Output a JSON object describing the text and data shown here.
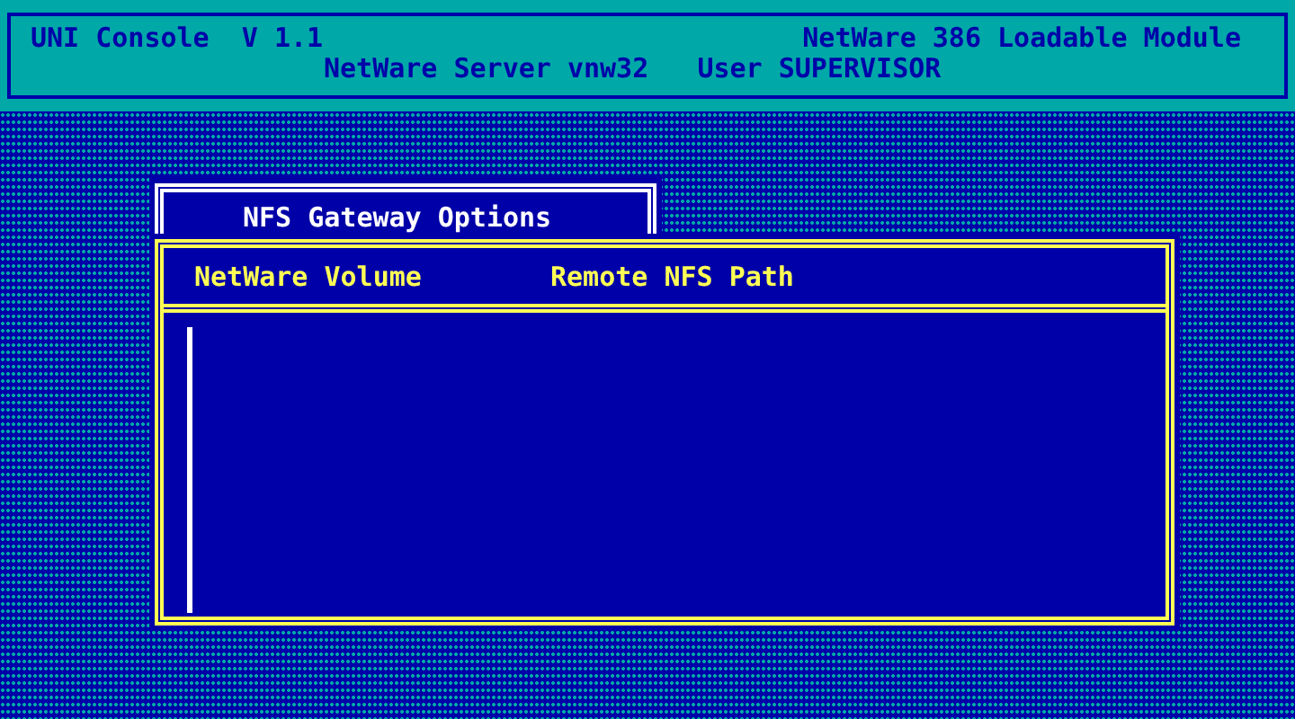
{
  "header": {
    "app_title": "UNI Console  V 1.1",
    "module_label": "NetWare 386 Loadable Module",
    "server_info": "NetWare Server vnw32   User SUPERVISOR"
  },
  "dialog": {
    "title": "NFS Gateway Options",
    "columns": [
      "NetWare Volume",
      "Remote NFS Path"
    ]
  }
}
